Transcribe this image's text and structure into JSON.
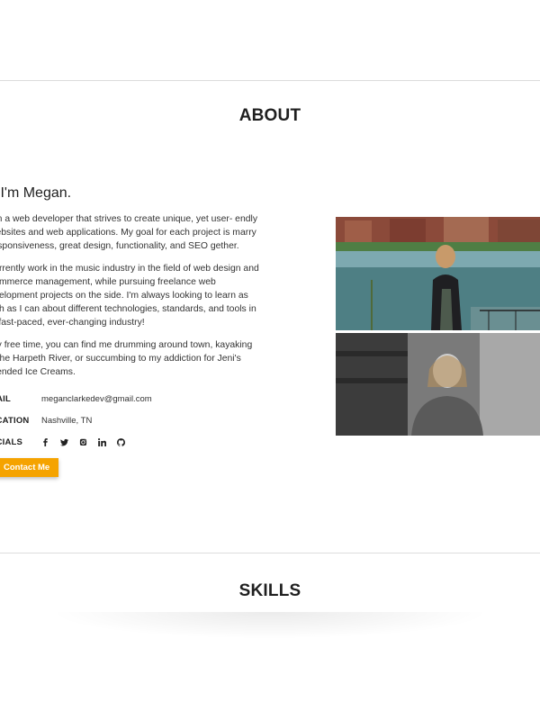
{
  "about": {
    "title": "ABOUT",
    "greeting": "i, I'm Megan.",
    "paragraphs": [
      "am a web developer that strives to create unique, yet user- endly websites and web applications. My goal for each project is marry responsiveness, great design, functionality, and SEO gether.",
      "currently work in the music industry in the field of web design and commerce management, while pursuing freelance web evelopment projects on the side. I'm always looking to learn as uch as I can about different technologies, standards, and tools in is fast-paced, ever-changing industry!",
      "my free time, you can find me drumming around town, kayaking n the Harpeth River, or succumbing to my addiction for Jeni's plended Ice Creams."
    ],
    "info": {
      "email_label": "MAIL",
      "email_value": "meganclarkedev@gmail.com",
      "location_label": "OCATION",
      "location_value": "Nashville, TN",
      "socials_label": "OCIALS"
    },
    "social_icons": [
      "facebook-icon",
      "twitter-icon",
      "instagram-icon",
      "linkedin-icon",
      "github-icon"
    ],
    "contact_button": "Contact Me"
  },
  "skills": {
    "title": "SKILLS"
  },
  "colors": {
    "accent": "#f5a300",
    "divider": "#dcdcdc"
  }
}
